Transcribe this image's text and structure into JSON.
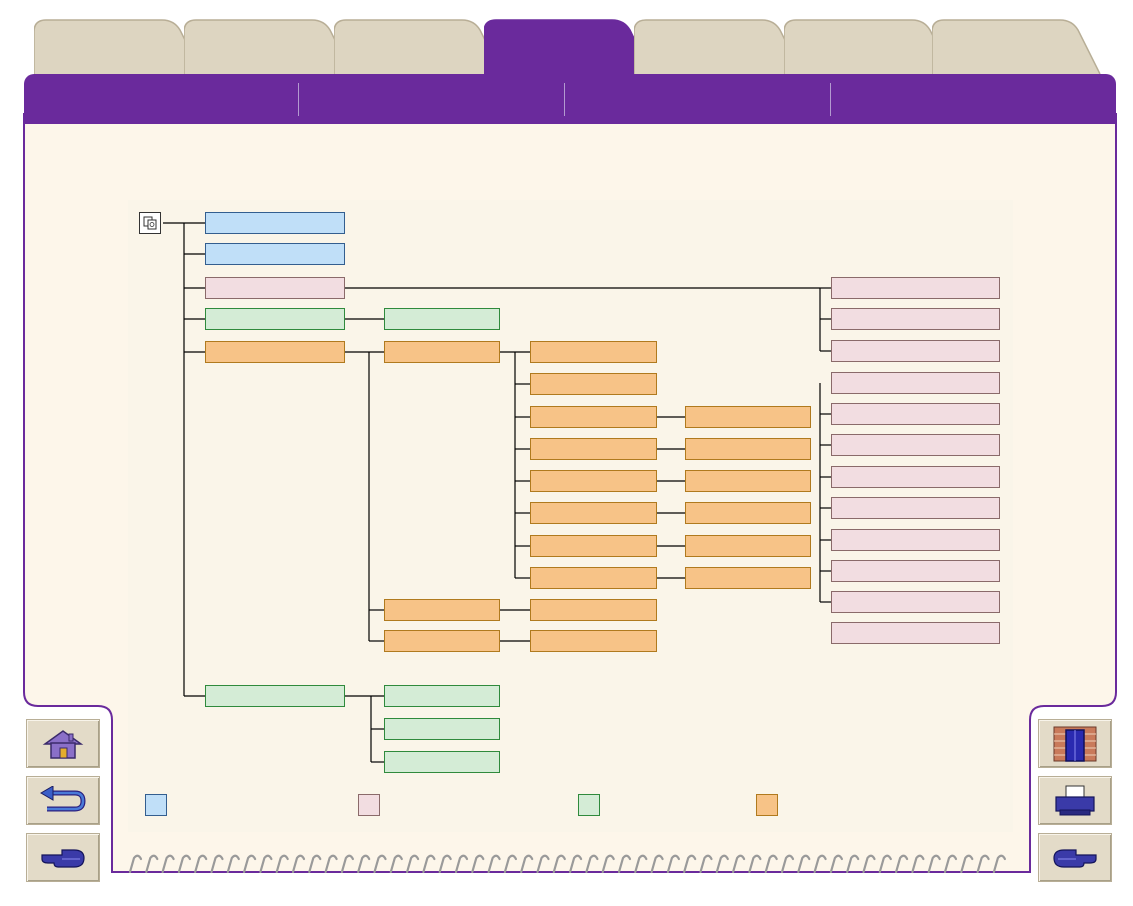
{
  "tabs": [
    {
      "label": ""
    },
    {
      "label": ""
    },
    {
      "label": ""
    },
    {
      "label": ""
    },
    {
      "label": ""
    },
    {
      "label": ""
    },
    {
      "label": ""
    }
  ],
  "header_sections": [
    {
      "label": ""
    },
    {
      "label": ""
    },
    {
      "label": ""
    },
    {
      "label": ""
    }
  ],
  "diagram": {
    "root_icon": "menu-tree-icon",
    "level1": [
      {
        "label": "",
        "color": "blue"
      },
      {
        "label": "",
        "color": "blue"
      },
      {
        "label": "",
        "color": "pink"
      },
      {
        "label": "",
        "color": "green"
      },
      {
        "label": "",
        "color": "orange"
      },
      {
        "label": "",
        "color": "green"
      }
    ],
    "pink_submenu": [
      "",
      "",
      "",
      "",
      "",
      "",
      "",
      "",
      "",
      "",
      "",
      ""
    ],
    "green_submenu_a": [
      ""
    ],
    "orange_level2": [
      "",
      "",
      ""
    ],
    "orange_level3": [
      "",
      "",
      "",
      "",
      "",
      "",
      "",
      ""
    ],
    "orange_level4": [
      "",
      "",
      "",
      "",
      "",
      ""
    ],
    "orange_level3_extra": [
      "",
      ""
    ],
    "green_submenu_b": [
      "",
      "",
      ""
    ]
  },
  "legend": [
    {
      "color": "#c0dff8",
      "text": ""
    },
    {
      "color": "#f2dde1",
      "text": ""
    },
    {
      "color": "#d4ecd6",
      "text": ""
    },
    {
      "color": "#f7c387",
      "text": ""
    }
  ],
  "colors": {
    "accent": "#6a2a9c",
    "page": "#fdf6ea",
    "panel": "#faf5e9",
    "tab_inactive": "#ddd5c1"
  },
  "nav_icons": {
    "home": "home-icon",
    "back": "back-arrow-icon",
    "prev": "pointing-hand-left-icon",
    "index": "door-icon",
    "print": "printer-icon",
    "next": "pointing-hand-right-icon"
  }
}
